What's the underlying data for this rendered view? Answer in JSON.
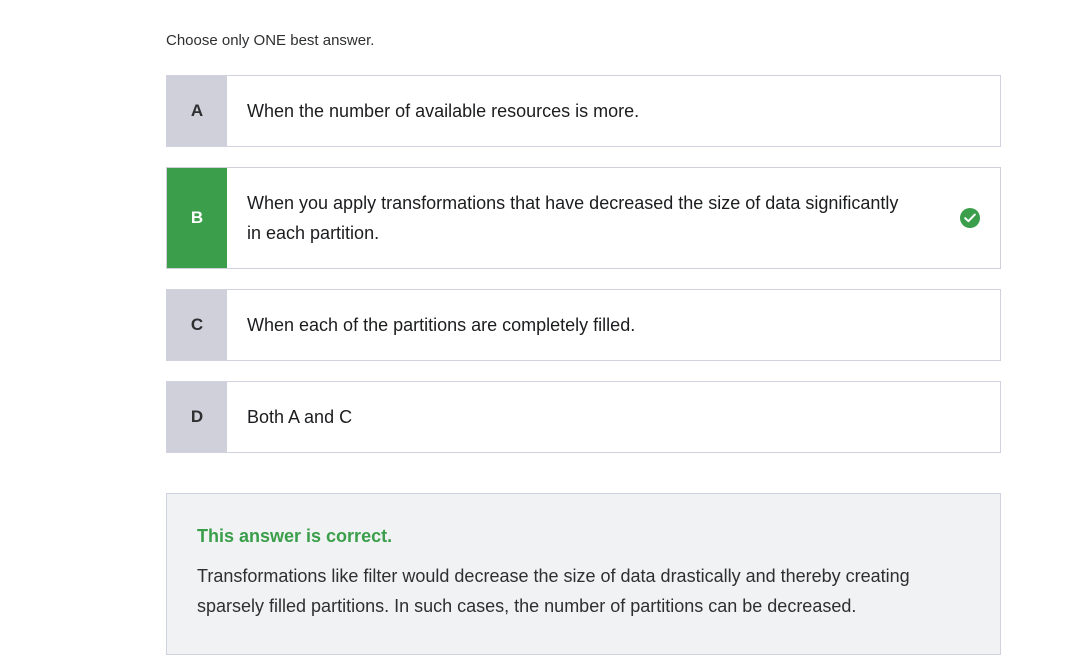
{
  "instruction": "Choose only ONE best answer.",
  "options": [
    {
      "letter": "A",
      "text": "When the number of available resources is more."
    },
    {
      "letter": "B",
      "text_line1": "When you apply transformations that have decreased the size of data significantly",
      "text_line2": "in each partition."
    },
    {
      "letter": "C",
      "text": "When each of the partitions are completely filled."
    },
    {
      "letter": "D",
      "text": "Both A and C"
    }
  ],
  "selected_option": "B",
  "feedback": {
    "title": "This answer is correct.",
    "text": "Transformations like filter would decrease the size of data drastically and thereby creating sparsely filled partitions. In such cases, the number of partitions can be decreased."
  },
  "colors": {
    "correct": "#3a9e4b",
    "letter_bg": "#cfd0da",
    "feedback_bg": "#f1f2f3"
  },
  "icons": {
    "correct_mark": "check-circle-icon"
  }
}
